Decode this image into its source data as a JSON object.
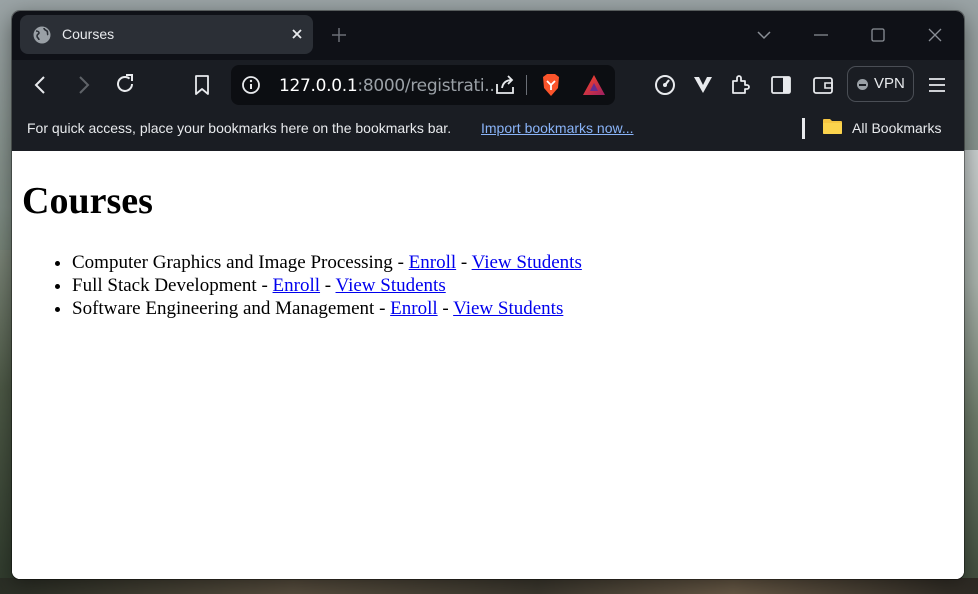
{
  "browser": {
    "tab": {
      "title": "Courses",
      "favicon": "globe-icon"
    },
    "toolbar": {
      "url_host": "127.0.0.1",
      "url_rest": ":8000/registrati...",
      "vpn_label": "VPN"
    },
    "bookmarks_bar": {
      "message": "For quick access, place your bookmarks here on the bookmarks bar.",
      "import_link": "Import bookmarks now...",
      "all_bookmarks": "All Bookmarks"
    },
    "colors": {
      "accent_link": "#8ab4f8",
      "brave_orange": "#fb542b"
    }
  },
  "page": {
    "heading": "Courses",
    "courses": [
      {
        "name": "Computer Graphics and Image Processing",
        "sep1": " - ",
        "enroll": "Enroll",
        "sep2": " - ",
        "view": "View Students"
      },
      {
        "name": "Full Stack Development",
        "sep1": " - ",
        "enroll": "Enroll",
        "sep2": " - ",
        "view": "View Students"
      },
      {
        "name": "Software Engineering and Management",
        "sep1": " - ",
        "enroll": "Enroll",
        "sep2": " - ",
        "view": "View Students"
      }
    ]
  }
}
